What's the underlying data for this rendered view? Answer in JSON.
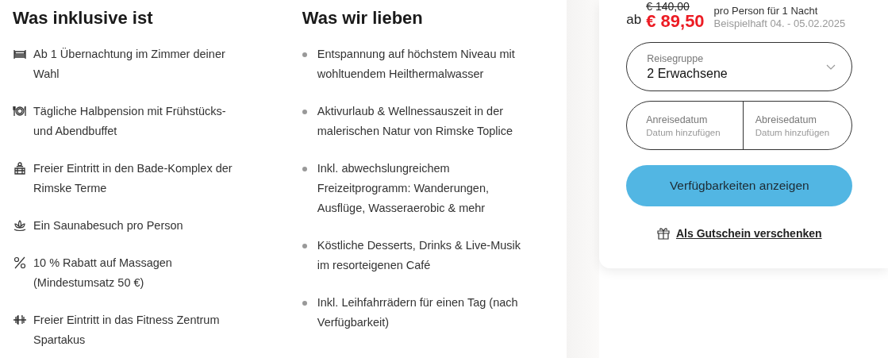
{
  "included": {
    "title": "Was inklusive ist",
    "items": [
      {
        "kind": "bed",
        "text": "Ab 1 Übernachtung im Zimmer deiner Wahl"
      },
      {
        "kind": "dining",
        "text": "Tägliche Halbpension mit Frühstücks- und Abendbuffet"
      },
      {
        "kind": "bath",
        "text": "Freier Eintritt in den Bade-Komplex der Rimske Terme"
      },
      {
        "kind": "lotus",
        "text": "Ein Saunabesuch pro Person"
      },
      {
        "kind": "percent",
        "text": "10 % Rabatt auf Massagen (Mindestumsatz 50 €)"
      },
      {
        "kind": "dumbbell",
        "text": "Freier Eintritt in das Fitness Zentrum Spartakus"
      }
    ]
  },
  "loved": {
    "title": "Was wir lieben",
    "items": [
      "Entspannung auf höchstem Niveau mit wohltuendem Heilthermalwasser",
      "Aktivurlaub & Wellnessauszeit in der malerischen Natur von Rimske Toplice",
      "Inkl. abwechslungreichem Freizeitprogramm: Wanderungen, Ausflüge, Wasseraerobic & mehr",
      "Köstliche Desserts, Drinks & Live-Musik im resorteigenen Café",
      "Inkl. Leihfahrrädern für einen Tag (nach Verfügbarkeit)"
    ]
  },
  "booking": {
    "old_price": "€ 140,00",
    "prefix": "ab",
    "price": "€ 89,50",
    "per": "pro Person für 1 Nacht",
    "example": "Beispielhaft 04. - 05.02.2025",
    "group": {
      "label": "Reisegruppe",
      "value": "2 Erwachsene"
    },
    "dates": [
      {
        "label": "Anreisedatum",
        "placeholder": "Datum hinzufügen"
      },
      {
        "label": "Abreisedatum",
        "placeholder": "Datum hinzufügen"
      }
    ],
    "button": "Verfügbarkeiten anzeigen",
    "gift_link": "Als Gutschein verschenken"
  }
}
